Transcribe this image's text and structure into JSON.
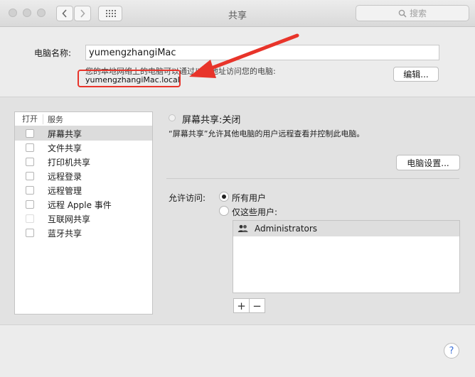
{
  "window": {
    "title": "共享",
    "search_placeholder": "搜索"
  },
  "computer_name": {
    "label": "电脑名称:",
    "value": "yumengzhangiMac",
    "description": "您的本地网络上的电脑可以通过以下地址访问您的电脑:",
    "hostname": "yumengzhangiMac.local",
    "edit_label": "编辑..."
  },
  "services": {
    "header_on": "打开",
    "header_service": "服务",
    "items": [
      {
        "label": "屏幕共享",
        "selected": true
      },
      {
        "label": "文件共享"
      },
      {
        "label": "打印机共享"
      },
      {
        "label": "远程登录"
      },
      {
        "label": "远程管理"
      },
      {
        "label": "远程 Apple 事件"
      },
      {
        "label": "互联网共享",
        "dim": true
      },
      {
        "label": "蓝牙共享"
      }
    ]
  },
  "detail": {
    "status": "屏幕共享:关闭",
    "description": "“屏幕共享”允许其他电脑的用户远程查看并控制此电脑。",
    "computer_settings_label": "电脑设置...",
    "allow_access_label": "允许访问:",
    "all_users_label": "所有用户",
    "only_users_label": "仅这些用户:",
    "selected_option": "all_users",
    "users": [
      "Administrators"
    ],
    "add_label": "+",
    "remove_label": "−"
  },
  "help_label": "?",
  "colors": {
    "annotation": "#e8342a"
  }
}
